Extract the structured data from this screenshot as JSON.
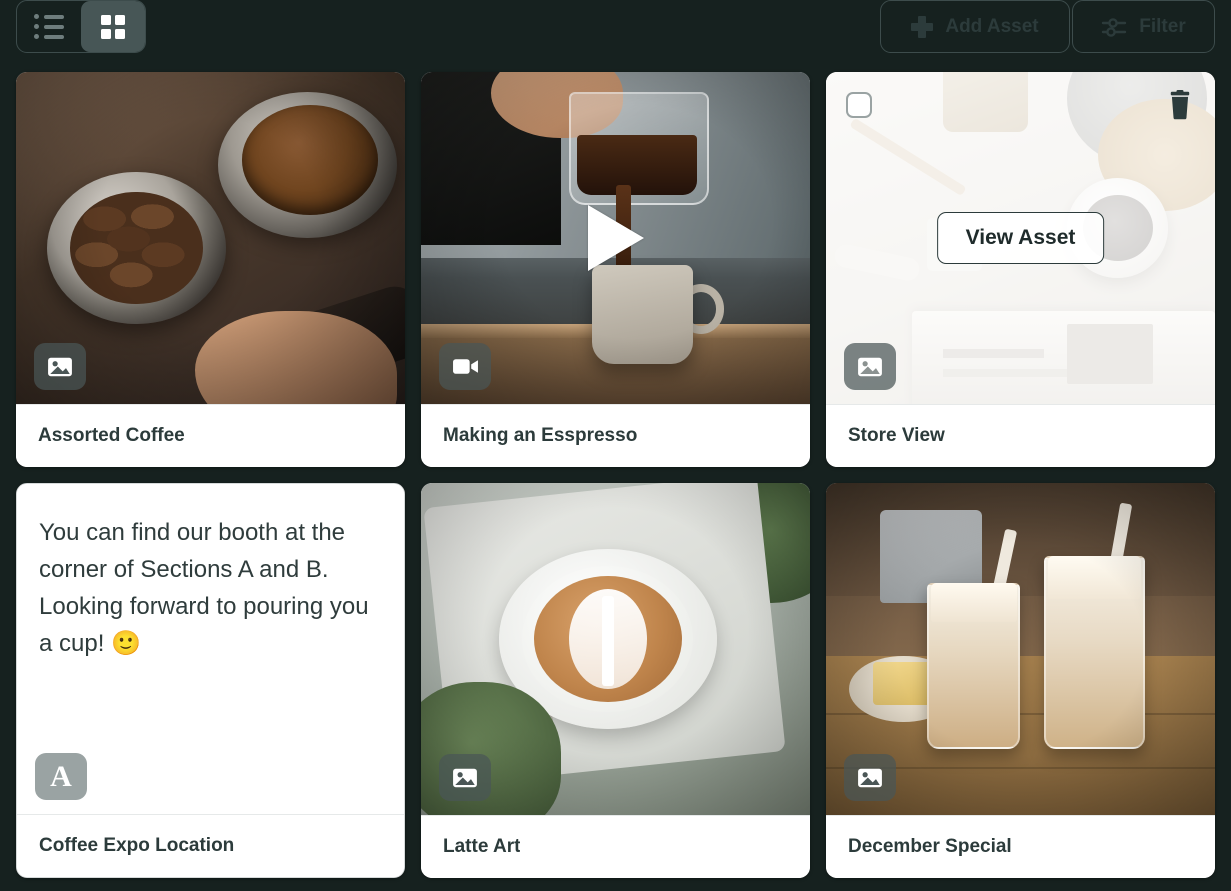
{
  "toolbar": {
    "view_toggle": {
      "list_label": "list-view",
      "grid_label": "grid-view",
      "active": "grid"
    },
    "add_asset_label": "Add Asset",
    "filter_label": "Filter"
  },
  "hover_card": {
    "view_asset_label": "View Asset",
    "delete_icon": "trash-icon",
    "select_icon": "checkbox-unchecked-icon"
  },
  "colors": {
    "background": "#16211f",
    "card_background": "#ffffff",
    "text": "#2c3b3b",
    "border": "#3d4c4c",
    "badge": "#4a5656",
    "text_badge": "#9aa3a3"
  },
  "assets": [
    {
      "title": "Assorted Coffee",
      "type": "image",
      "badge_icon": "image-icon",
      "art": "a1",
      "state": "default"
    },
    {
      "title": "Making an Esspresso",
      "type": "video",
      "badge_icon": "video-icon",
      "art": "a2",
      "state": "default"
    },
    {
      "title": "Store View",
      "type": "image",
      "badge_icon": "image-icon",
      "art": "a3",
      "state": "hover"
    },
    {
      "title": "Coffee Expo Location",
      "type": "text",
      "badge_icon": "text-icon",
      "badge_letter": "A",
      "body": "You can find our booth at the corner of Sections A and B. Looking forward to pouring you a cup! 🙂",
      "state": "default"
    },
    {
      "title": "Latte Art",
      "type": "image",
      "badge_icon": "image-icon",
      "art": "a4",
      "state": "default"
    },
    {
      "title": "December Special",
      "type": "image",
      "badge_icon": "image-icon",
      "art": "a5",
      "state": "default"
    }
  ]
}
